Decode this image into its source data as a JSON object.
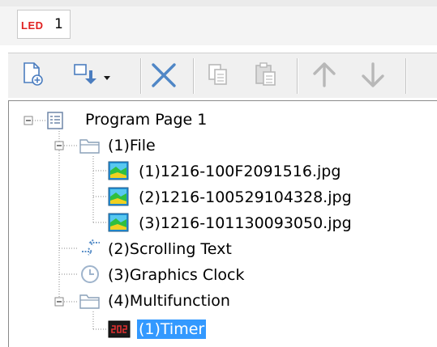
{
  "tabs": [
    {
      "badge": "LED",
      "number": "1"
    }
  ],
  "toolbar": {
    "buttons": [
      {
        "icon": "new-page-icon",
        "enabled": true
      },
      {
        "icon": "add-item-dropdown-icon",
        "enabled": true
      },
      {
        "icon": "delete-icon",
        "enabled": true
      },
      {
        "icon": "copy-icon",
        "enabled": false
      },
      {
        "icon": "paste-icon",
        "enabled": false
      },
      {
        "icon": "move-up-icon",
        "enabled": false
      },
      {
        "icon": "move-down-icon",
        "enabled": false
      }
    ]
  },
  "tree": {
    "program": {
      "label": "Program Page 1",
      "icon": "program-page-icon",
      "expanded": true
    },
    "items": [
      {
        "label": "(1)File",
        "icon": "folder-icon",
        "expanded": true,
        "children": [
          {
            "label": "(1)1216-100F2091516.jpg",
            "icon": "image-file-icon"
          },
          {
            "label": "(2)1216-100529104328.jpg",
            "icon": "image-file-icon"
          },
          {
            "label": "(3)1216-101130093050.jpg",
            "icon": "image-file-icon"
          }
        ]
      },
      {
        "label": "(2)Scrolling Text",
        "icon": "scrolling-text-icon"
      },
      {
        "label": "(3)Graphics Clock",
        "icon": "clock-icon"
      },
      {
        "label": "(4)Multifunction",
        "icon": "folder-icon",
        "expanded": true,
        "children": [
          {
            "label": "(1)Timer",
            "icon": "timer-icon",
            "selected": true
          }
        ]
      }
    ]
  },
  "colors": {
    "selection": "#3399ff",
    "led_badge": "#e02020",
    "toolbar_active": "#5b8fd0",
    "toolbar_disabled": "#b8b8b8"
  }
}
